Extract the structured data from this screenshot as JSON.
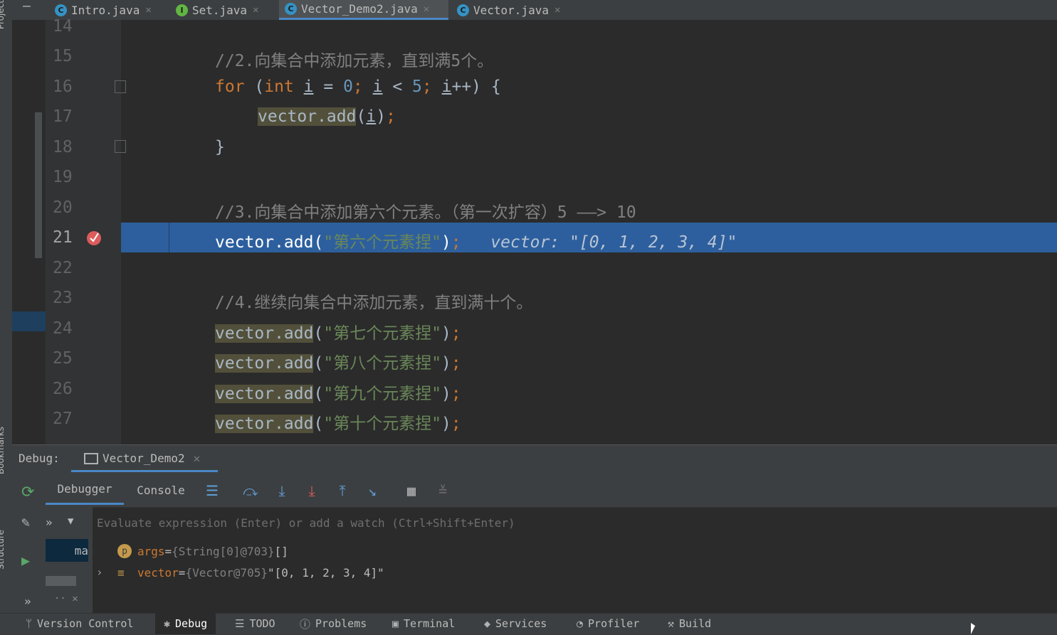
{
  "tabs": [
    {
      "icon": "C",
      "label": "Intro.java",
      "color": "#3592c4"
    },
    {
      "icon": "I",
      "label": "Set.java",
      "color": "#62b543"
    },
    {
      "icon": "C",
      "label": "Vector_Demo2.java",
      "color": "#3592c4"
    },
    {
      "icon": "C",
      "label": "Vector.java",
      "color": "#3592c4"
    }
  ],
  "side_labels": {
    "project": "Project",
    "bookmarks": "Bookmarks",
    "structure": "Structure"
  },
  "editor": {
    "line_numbers": [
      "14",
      "15",
      "16",
      "17",
      "18",
      "19",
      "20",
      "21",
      "22",
      "23",
      "24",
      "25",
      "26",
      "27"
    ],
    "current_line": "21",
    "l15_comment": "//2.向集合中添加元素，直到满5个。",
    "l16": {
      "for": "for",
      "open": " (",
      "int": "int",
      "i1": "i",
      "eq": " = ",
      "zero": "0",
      "semi1": ";",
      "sp1": " ",
      "i2": "i",
      "lt": " < ",
      "five": "5",
      "semi2": ";",
      "sp2": " ",
      "i3": "i",
      "rest": "++) {"
    },
    "l17": {
      "call": "vector.add",
      "open": "(",
      "arg": "i",
      "close": ")",
      "semi": ";"
    },
    "l18": "}",
    "l20_comment": "//3.向集合中添加第六个元素。（第一次扩容）5 ——> 10",
    "l21": {
      "call": "vector.add(",
      "str": "\"第六个元素捏\"",
      "close": ")",
      "semi": ";",
      "inline_value": "vector: \"[0, 1, 2, 3, 4]\""
    },
    "l23_comment": "//4.继续向集合中添加元素，直到满十个。",
    "adds": [
      {
        "call": "vector.add",
        "open": "(",
        "str": "\"第七个元素捏\"",
        "close": ")",
        "semi": ";"
      },
      {
        "call": "vector.add",
        "open": "(",
        "str": "\"第八个元素捏\"",
        "close": ")",
        "semi": ";"
      },
      {
        "call": "vector.add",
        "open": "(",
        "str": "\"第九个元素捏\"",
        "close": ")",
        "semi": ";"
      },
      {
        "call": "vector.add",
        "open": "(",
        "str": "\"第十个元素捏\"",
        "close": ")",
        "semi": ";"
      }
    ]
  },
  "debug": {
    "label": "Debug:",
    "session": "Vector_Demo2",
    "tabs": {
      "debugger": "Debugger",
      "console": "Console"
    },
    "eval_placeholder": "Evaluate expression (Enter) or add a watch (Ctrl+Shift+Enter)",
    "frame": "ma",
    "more": "»",
    "variables": [
      {
        "badge": "p",
        "name": "args",
        "eq": " = ",
        "type": "{String[0]@703}",
        "value": " []"
      },
      {
        "badge": "≡",
        "name": "vector",
        "eq": " = ",
        "type": "{Vector@705}",
        "value": " \"[0, 1, 2, 3, 4]\""
      }
    ]
  },
  "bottom_bar": [
    {
      "icon": "branch-icon",
      "glyph": "ᛘ",
      "label": "Version Control"
    },
    {
      "icon": "bug-icon",
      "glyph": "✱",
      "label": "Debug"
    },
    {
      "icon": "list-icon",
      "glyph": "☰",
      "label": "TODO"
    },
    {
      "icon": "info-icon",
      "glyph": "ⓘ",
      "label": "Problems"
    },
    {
      "icon": "terminal-icon",
      "glyph": "▣",
      "label": "Terminal"
    },
    {
      "icon": "services-icon",
      "glyph": "◆",
      "label": "Services"
    },
    {
      "icon": "profiler-icon",
      "glyph": "◔",
      "label": "Profiler"
    },
    {
      "icon": "hammer-icon",
      "glyph": "⚒",
      "label": "Build"
    }
  ],
  "colors": {
    "selection": "#2d5f9e",
    "breakpoint": "#db5c5c",
    "accent": "#4a88c7"
  }
}
